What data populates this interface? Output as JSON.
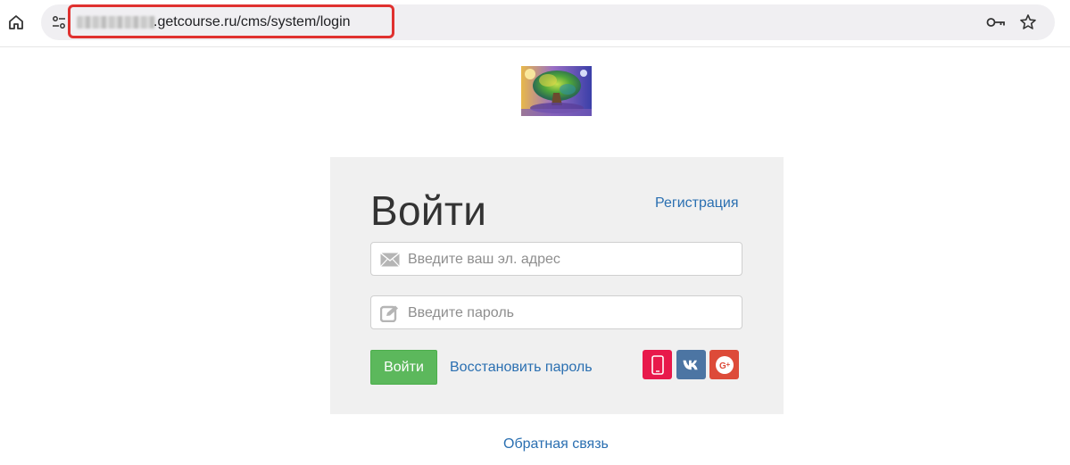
{
  "browser": {
    "url_visible": ".getcourse.ru/cms/system/login"
  },
  "login": {
    "title": "Войти",
    "register_link": "Регистрация",
    "email_placeholder": "Введите ваш эл. адрес",
    "password_placeholder": "Введите пароль",
    "submit_label": "Войти",
    "restore_link": "Восстановить пароль",
    "social_icons": [
      "phone-icon",
      "vk-icon",
      "google-plus-icon"
    ]
  },
  "footer": {
    "feedback_link": "Обратная связь"
  },
  "colors": {
    "link": "#2a6fb1",
    "submit_button": "#5cb85c",
    "panel_background": "#f0f0f0",
    "url_highlight": "#e0312f",
    "phone_button": "#e8194b",
    "vk_button": "#4c75a3",
    "google_plus_button": "#dd4b39"
  }
}
